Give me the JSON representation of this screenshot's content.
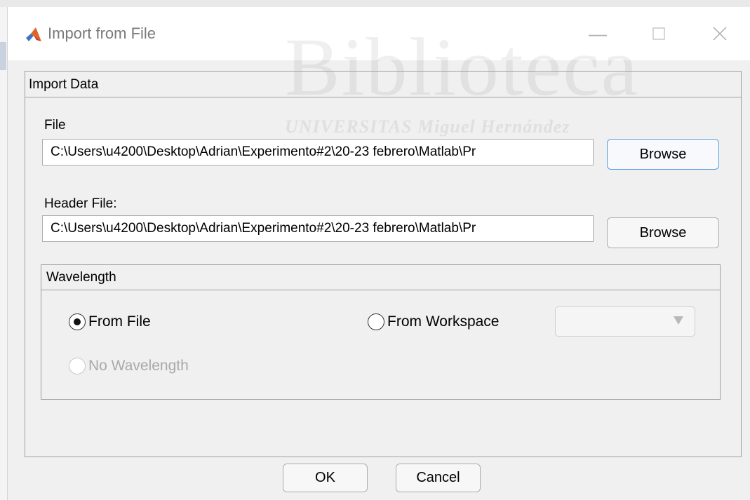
{
  "window": {
    "title": "Import from File",
    "watermark": "Biblioteca",
    "watermark_sub": "UNIVERSITAS Miguel Hernández"
  },
  "import_panel": {
    "title": "Import Data",
    "file_label": "File",
    "file_value": "C:\\Users\\u4200\\Desktop\\Adrian\\Experimento#2\\20-23 febrero\\Matlab\\Pr",
    "header_label": "Header File:",
    "header_value": "C:\\Users\\u4200\\Desktop\\Adrian\\Experimento#2\\20-23 febrero\\Matlab\\Pr",
    "browse_label": "Browse"
  },
  "wavelength_panel": {
    "title": "Wavelength",
    "options": [
      {
        "label": "From File",
        "selected": true,
        "enabled": true
      },
      {
        "label": "From Workspace",
        "selected": false,
        "enabled": true
      },
      {
        "label": "No Wavelength",
        "selected": false,
        "enabled": false
      }
    ],
    "workspace_select": ""
  },
  "footer": {
    "ok_label": "OK",
    "cancel_label": "Cancel"
  },
  "icons": [
    "matlab-logo-icon",
    "minimize-icon",
    "maximize-icon",
    "close-icon",
    "dropdown-arrow-icon"
  ]
}
